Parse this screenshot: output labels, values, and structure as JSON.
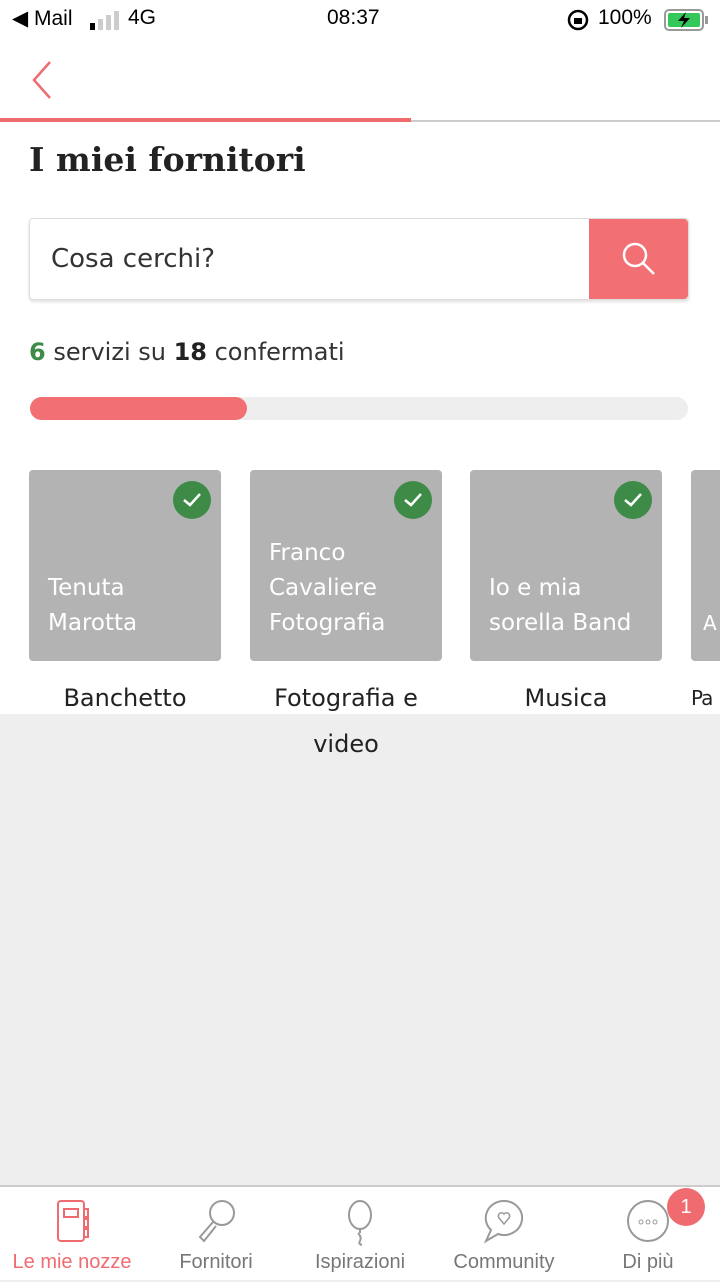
{
  "status_bar": {
    "back_app": "◀ Mail",
    "network": "4G",
    "time": "08:37",
    "battery": "100%"
  },
  "page": {
    "title": "I miei fornitori"
  },
  "search": {
    "placeholder": "Cosa cerchi?"
  },
  "summary": {
    "confirmed": "6",
    "text_mid": " servizi su ",
    "total": "18",
    "text_end": " confermati",
    "progress_percent": 33
  },
  "cards": [
    {
      "name": "Tenuta Marotta",
      "category": "Banchetto",
      "confirmed": true
    },
    {
      "name": "Franco Cavaliere Fotografia",
      "category": "Fotografia e video",
      "confirmed": true
    },
    {
      "name": "Io e mia sorella Band",
      "category": "Musica",
      "confirmed": true
    },
    {
      "name": "A",
      "category": "Pa",
      "confirmed": false
    }
  ],
  "tabbar": {
    "items": [
      {
        "label": "Le mie nozze",
        "icon": "notebook-icon",
        "active": true
      },
      {
        "label": "Fornitori",
        "icon": "magnifier-icon"
      },
      {
        "label": "Ispirazioni",
        "icon": "balloon-icon"
      },
      {
        "label": "Community",
        "icon": "chat-heart-icon"
      },
      {
        "label": "Di più",
        "icon": "more-icon"
      }
    ],
    "badge": "1"
  },
  "colors": {
    "accent": "#f26f73",
    "confirmed": "#3e8b47"
  }
}
